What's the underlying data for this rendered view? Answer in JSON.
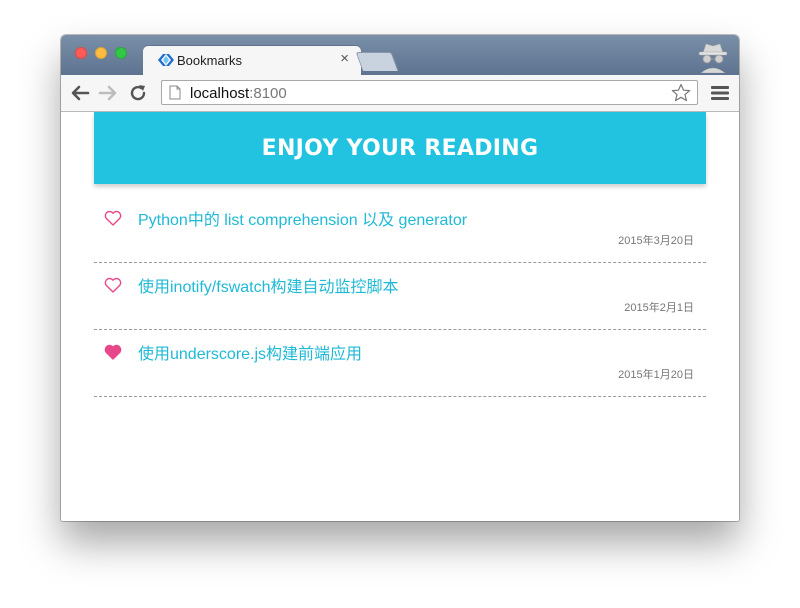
{
  "browser": {
    "tab": {
      "title": "Bookmarks",
      "close": "×"
    },
    "address": {
      "host": "localhost",
      "port": ":8100"
    }
  },
  "page": {
    "banner_title": "ENJOY YOUR READING",
    "items": [
      {
        "title": "Python中的 list comprehension 以及 generator",
        "date": "2015年3月20日",
        "favorited": false
      },
      {
        "title": "使用inotify/fswatch构建自动监控脚本",
        "date": "2015年2月1日",
        "favorited": false
      },
      {
        "title": "使用underscore.js构建前端应用",
        "date": "2015年1月20日",
        "favorited": true
      }
    ]
  },
  "colors": {
    "banner": "#22c3e0",
    "link": "#20b9d6",
    "heart": "#e8488a"
  }
}
